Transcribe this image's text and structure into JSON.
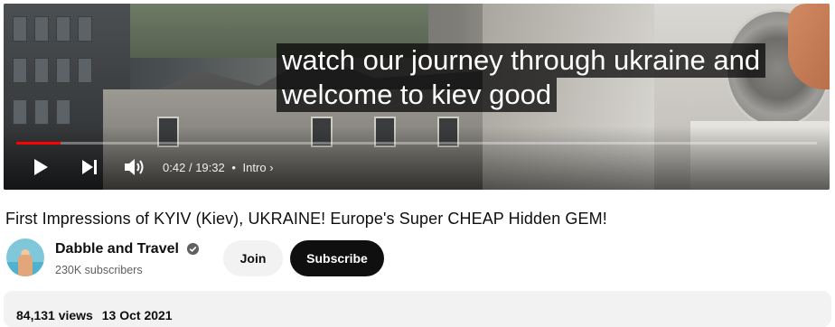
{
  "player": {
    "caption_lines": [
      "watch our journey through ukraine and",
      "welcome to kiev good"
    ],
    "time_current": "0:42",
    "time_total": "19:32",
    "time_separator": "/",
    "chapter": "Intro",
    "progress_fraction": 0.055,
    "colors": {
      "progress": "#ff0000"
    },
    "icons": [
      "play-icon",
      "next-icon",
      "volume-icon",
      "chevron-right-icon"
    ]
  },
  "video": {
    "title": "First Impressions of KYIV (Kiev), UKRAINE! Europe's Super CHEAP Hidden GEM!"
  },
  "channel": {
    "name": "Dabble and Travel",
    "subscribers": "230K subscribers",
    "join_label": "Join",
    "subscribe_label": "Subscribe",
    "icons": [
      "verified-icon",
      "avatar"
    ]
  },
  "description": {
    "views": "84,131 views",
    "date": "13 Oct 2021"
  }
}
